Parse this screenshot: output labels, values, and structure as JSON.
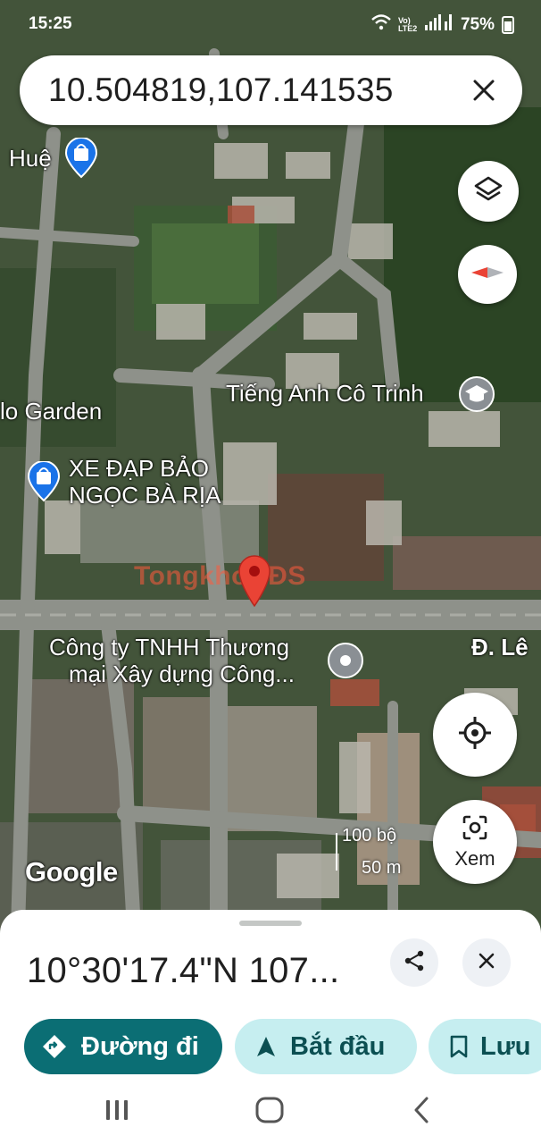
{
  "status_bar": {
    "time": "15:25",
    "battery": "75%",
    "net_label": "Vo) LTE2"
  },
  "search": {
    "query": "10.504819,107.141535"
  },
  "map_labels": {
    "poi_hue": "Huệ",
    "poi_garden": "lo Garden",
    "poi_school": "Tiếng Anh Cô Trinh",
    "poi_bike_line1": "XE ĐẠP BẢO",
    "poi_bike_line2": "NGỌC BÀ RỊA",
    "poi_company_line1": "Công ty TNHH Thương",
    "poi_company_line2": "mại Xây dựng Công...",
    "street": "Đ. Lê",
    "watermark": "TongkhoBĐS",
    "google": "Google",
    "scale_ft": "100 bộ",
    "scale_m": "50 m"
  },
  "controls": {
    "lens_label": "Xem"
  },
  "sheet": {
    "coords": "10°30'17.4\"N 107...",
    "directions_label": "Đường đi",
    "start_label": "Bắt đầu",
    "save_label": "Lưu"
  },
  "colors": {
    "primary": "#0b6e74",
    "chip_bg": "#c6eef0",
    "pin": "#ea4335",
    "poi_blue": "#1a73e8"
  },
  "icons": [
    "wifi-icon",
    "signal-icon",
    "battery-icon",
    "close-icon",
    "layers-icon",
    "compass-icon",
    "locate-icon",
    "lens-icon",
    "share-icon",
    "directions-icon",
    "navigate-icon",
    "bookmark-icon",
    "recent-apps-icon",
    "home-icon",
    "back-icon",
    "shopping-bag-icon",
    "graduation-cap-icon",
    "place-icon"
  ]
}
